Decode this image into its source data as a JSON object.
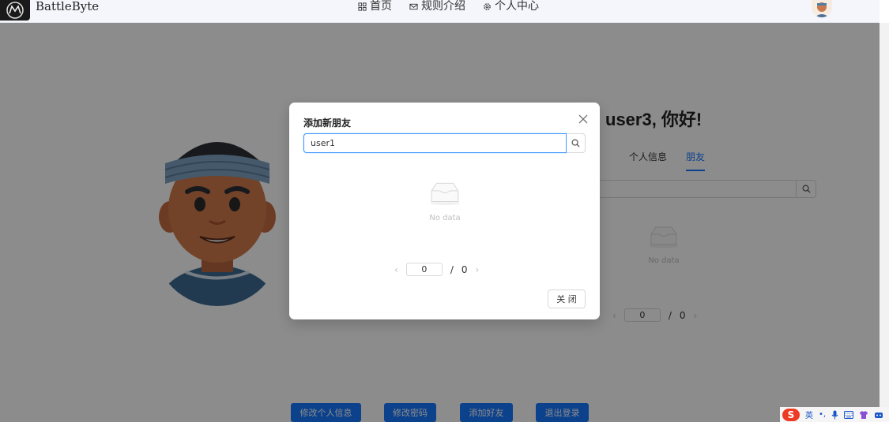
{
  "navbar": {
    "brand": "BattleByte",
    "menu": [
      {
        "label": "首页",
        "icon": "grid-icon"
      },
      {
        "label": "规则介绍",
        "icon": "mail-icon"
      },
      {
        "label": "个人中心",
        "icon": "gear-icon"
      }
    ]
  },
  "profile": {
    "greeting": "user3, 你好!",
    "tabs": [
      {
        "label": "个人信息",
        "active": false
      },
      {
        "label": "朋友",
        "active": true
      }
    ],
    "empty_text": "No data",
    "pager": {
      "current": "0",
      "separator": "/",
      "total": "0"
    }
  },
  "actions": {
    "edit_profile": "修改个人信息",
    "change_password": "修改密码",
    "add_friend": "添加好友",
    "logout": "退出登录"
  },
  "modal": {
    "title": "添加新朋友",
    "search_value": "user1",
    "empty_text": "No data",
    "pager": {
      "current": "0",
      "separator": "/",
      "total": "0"
    },
    "close_label": "关 闭"
  },
  "ime": {
    "logo": "S",
    "lang": "英",
    "punct": "•,"
  },
  "colors": {
    "primary": "#1677ff",
    "mask": "rgba(0,0,0,0.45)"
  }
}
